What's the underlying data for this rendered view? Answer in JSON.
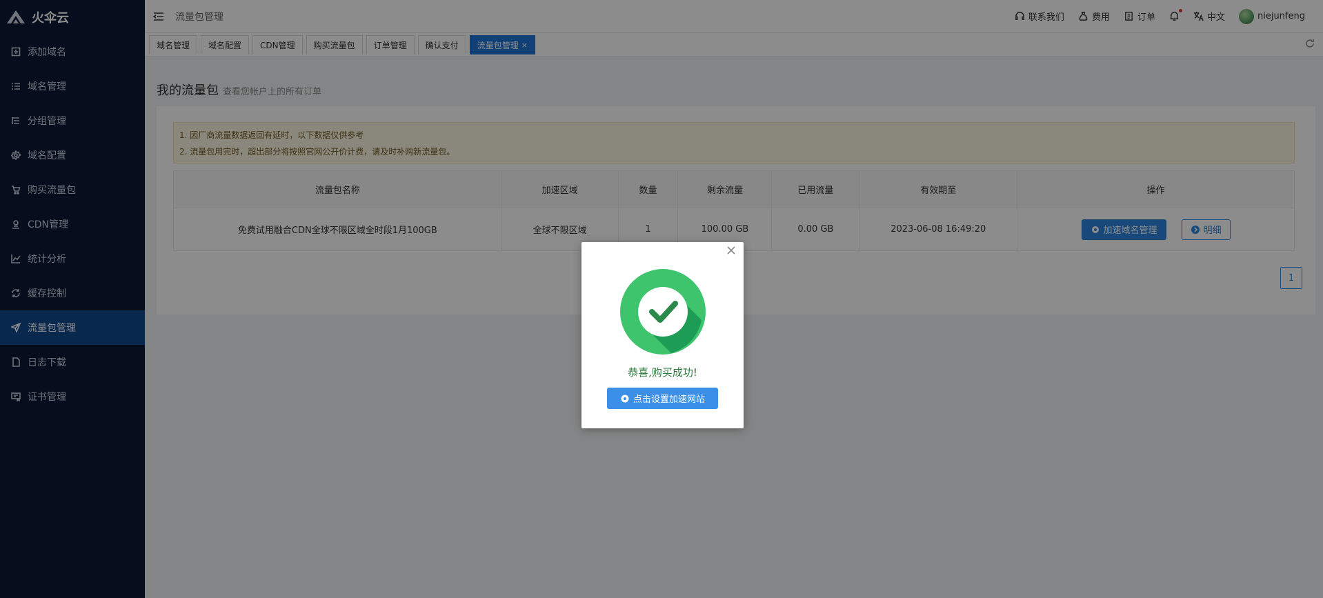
{
  "brand": {
    "name": "火伞云"
  },
  "sidebar": {
    "items": [
      {
        "label": "添加域名",
        "icon": "plus-square-icon",
        "active": false
      },
      {
        "label": "域名管理",
        "icon": "list-icon",
        "active": false
      },
      {
        "label": "分组管理",
        "icon": "group-list-icon",
        "active": false
      },
      {
        "label": "域名配置",
        "icon": "gear-icon",
        "active": false
      },
      {
        "label": "购买流量包",
        "icon": "cart-icon",
        "active": false
      },
      {
        "label": "CDN管理",
        "icon": "cdn-icon",
        "active": false
      },
      {
        "label": "统计分析",
        "icon": "line-chart-icon",
        "active": false
      },
      {
        "label": "缓存控制",
        "icon": "refresh-icon",
        "active": false
      },
      {
        "label": "流量包管理",
        "icon": "send-icon",
        "active": true
      },
      {
        "label": "日志下载",
        "icon": "file-icon",
        "active": false
      },
      {
        "label": "证书管理",
        "icon": "certificate-icon",
        "active": false
      }
    ]
  },
  "header": {
    "crumb": "流量包管理",
    "contact": "联系我们",
    "fees": "费用",
    "orders": "订单",
    "language": "中文",
    "username": "niejunfeng"
  },
  "tabs": [
    {
      "label": "域名管理",
      "active": false
    },
    {
      "label": "域名配置",
      "active": false
    },
    {
      "label": "CDN管理",
      "active": false
    },
    {
      "label": "购买流量包",
      "active": false
    },
    {
      "label": "订单管理",
      "active": false
    },
    {
      "label": "确认支付",
      "active": false
    },
    {
      "label": "流量包管理",
      "active": true,
      "close": "×"
    }
  ],
  "main": {
    "title": "我的流量包",
    "subtitle": "查看您帐户上的所有订单",
    "notices": [
      "1. 因厂商流量数据返回有延时，以下数据仅供参考",
      "2. 流量包用完时，超出部分将按照官网公开价计费，请及时补购新流量包。"
    ],
    "table": {
      "headers": [
        "流量包名称",
        "加速区域",
        "数量",
        "剩余流量",
        "已用流量",
        "有效期至",
        "操作"
      ],
      "rows": [
        {
          "name": "免费试用融合CDN全球不限区域全时段1月100GB",
          "region": "全球不限区域",
          "quantity": "1",
          "remaining": "100.00 GB",
          "used": "0.00 GB",
          "expires": "2023-06-08 16:49:20",
          "action_manage": "加速域名管理",
          "action_detail": "明细"
        }
      ]
    },
    "pager": {
      "current": "1"
    }
  },
  "modal": {
    "message": "恭喜,购买成功!",
    "button": "点击设置加速网站"
  },
  "colors": {
    "sidebar_bg": "#0b1833",
    "sidebar_active": "#0f4a8f",
    "accent": "#2f86e0",
    "success_green": "#3ec46d"
  }
}
